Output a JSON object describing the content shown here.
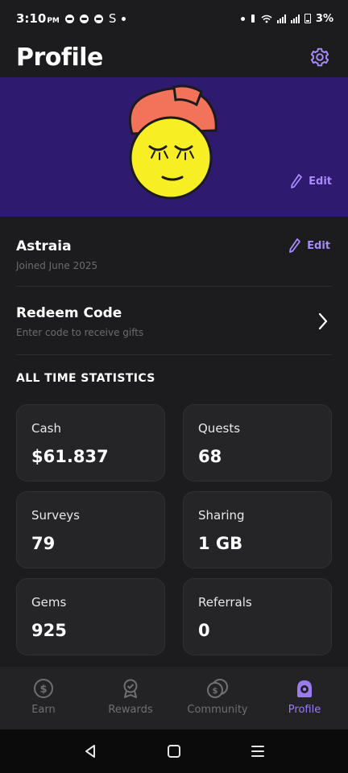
{
  "status_bar": {
    "time": "3:10",
    "ampm": "PM",
    "carrier_letter": "S",
    "battery": "3%"
  },
  "header": {
    "title": "Profile",
    "settings_icon": "gear-icon"
  },
  "banner": {
    "edit_label": "Edit",
    "background_color": "#2e1a6e",
    "avatar": "yellow-face-with-orange-cap"
  },
  "profile": {
    "name": "Astraia",
    "joined": "Joined June 2025",
    "edit_label": "Edit"
  },
  "redeem": {
    "title": "Redeem Code",
    "subtitle": "Enter code to receive gifts"
  },
  "stats": {
    "section_title": "ALL TIME STATISTICS",
    "items": [
      {
        "label": "Cash",
        "value": "$61.837"
      },
      {
        "label": "Quests",
        "value": "68"
      },
      {
        "label": "Surveys",
        "value": "79"
      },
      {
        "label": "Sharing",
        "value": "1 GB"
      },
      {
        "label": "Gems",
        "value": "925"
      },
      {
        "label": "Referrals",
        "value": "0"
      }
    ]
  },
  "bottom_nav": {
    "items": [
      {
        "label": "Earn",
        "icon": "dollar-coin-icon",
        "active": false
      },
      {
        "label": "Rewards",
        "icon": "award-badge-icon",
        "active": false
      },
      {
        "label": "Community",
        "icon": "coins-stack-icon",
        "active": false
      },
      {
        "label": "Profile",
        "icon": "profile-icon",
        "active": true
      }
    ]
  },
  "colors": {
    "accent": "#a78bfa",
    "nav_active": "#9b7bf0",
    "background": "#1c1c1e",
    "card": "#252528"
  }
}
